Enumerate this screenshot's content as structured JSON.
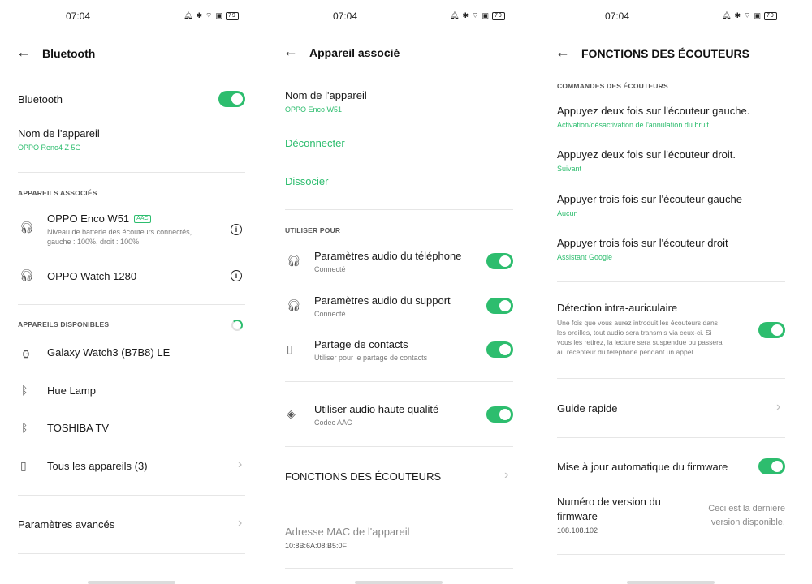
{
  "screen1": {
    "status": {
      "time": "07:04",
      "battery": "79"
    },
    "header": {
      "title": "Bluetooth"
    },
    "bluetooth_label": "Bluetooth",
    "device_name": {
      "title": "Nom de l'appareil",
      "value": "OPPO Reno4 Z 5G"
    },
    "paired_section": "APPAREILS ASSOCIÉS",
    "paired": [
      {
        "name": "OPPO Enco W51",
        "badge": "AAC",
        "detail1": "Niveau de batterie des écouteurs connectés,",
        "detail2": "gauche : 100%, droit : 100%"
      },
      {
        "name": "OPPO Watch 1280"
      }
    ],
    "available_section": "APPAREILS DISPONIBLES",
    "available": [
      {
        "name": "Galaxy Watch3 (B7B8) LE"
      },
      {
        "name": "Hue Lamp"
      },
      {
        "name": "TOSHIBA TV"
      },
      {
        "name": "Tous les appareils (3)"
      }
    ],
    "advanced": "Paramètres avancés"
  },
  "screen2": {
    "status": {
      "time": "07:04",
      "battery": "79"
    },
    "header": {
      "title": "Appareil associé"
    },
    "device_name": {
      "title": "Nom de l'appareil",
      "value": "OPPO Enco W51"
    },
    "disconnect": "Déconnecter",
    "unpair": "Dissocier",
    "use_for_section": "UTILISER POUR",
    "use_for": [
      {
        "title": "Paramètres audio du téléphone",
        "sub": "Connecté"
      },
      {
        "title": "Paramètres audio du support",
        "sub": "Connecté"
      },
      {
        "title": "Partage de contacts",
        "sub": "Utiliser pour le partage de contacts"
      }
    ],
    "hq_audio": {
      "title": "Utiliser audio haute qualité",
      "sub": "Codec AAC"
    },
    "earbud_functions": "FONCTIONS DES ÉCOUTEURS",
    "mac": {
      "title": "Adresse MAC de l'appareil",
      "value": "10:8B:6A:08:B5:0F"
    }
  },
  "screen3": {
    "status": {
      "time": "07:04",
      "battery": "79"
    },
    "header": {
      "title": "FONCTIONS DES ÉCOUTEURS"
    },
    "controls_section": "COMMANDES DES ÉCOUTEURS",
    "controls": [
      {
        "title": "Appuyez deux fois sur l'écouteur gauche.",
        "value": "Activation/désactivation de l'annulation du bruit"
      },
      {
        "title": "Appuyez deux fois sur l'écouteur droit.",
        "value": "Suivant"
      },
      {
        "title": "Appuyer trois fois sur l'écouteur gauche",
        "value": "Aucun"
      },
      {
        "title": "Appuyer trois fois sur l'écouteur droit",
        "value": "Assistant Google"
      }
    ],
    "in_ear": {
      "title": "Détection intra-auriculaire",
      "desc1": "Une fois que vous aurez introduit les écouteurs dans",
      "desc2": "les oreilles, tout audio sera transmis via ceux-ci. Si",
      "desc3": "vous les retirez, la lecture sera suspendue ou passera",
      "desc4": "au récepteur du téléphone pendant un appel."
    },
    "quick_guide": "Guide rapide",
    "auto_update": "Mise à jour automatique du firmware",
    "firmware": {
      "title1": "Numéro de version du",
      "title2": "firmware",
      "value": "108.108.102",
      "note1": "Ceci est la dernière",
      "note2": "version disponible."
    }
  }
}
